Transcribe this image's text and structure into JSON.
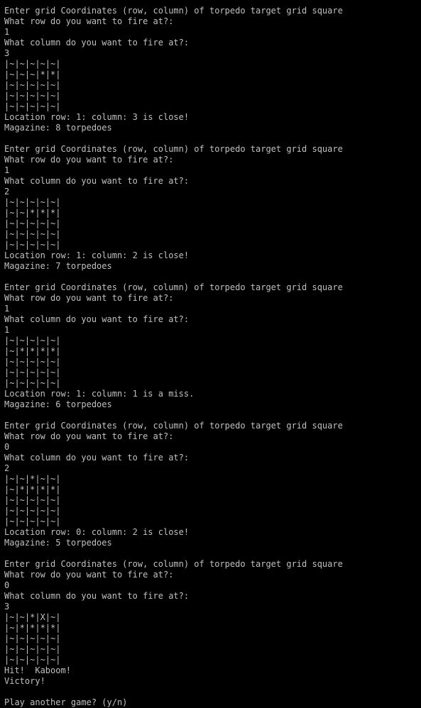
{
  "colors": {
    "background": "#000000",
    "text": "#c0c0c0"
  },
  "console": {
    "rounds": [
      {
        "prompt": "Enter grid Coordinates (row, column) of torpedo target grid square",
        "row_question": "What row do you want to fire at?:",
        "row_answer": "1",
        "column_question": "What column do you want to fire at?:",
        "column_answer": "3",
        "grid": [
          "|~|~|~|~|~|",
          "|~|~|~|*|*|",
          "|~|~|~|~|~|",
          "|~|~|~|~|~|",
          "|~|~|~|~|~|"
        ],
        "result": "Location row: 1: column: 3 is close!",
        "magazine": "Magazine: 8 torpedoes"
      },
      {
        "prompt": "Enter grid Coordinates (row, column) of torpedo target grid square",
        "row_question": "What row do you want to fire at?:",
        "row_answer": "1",
        "column_question": "What column do you want to fire at?:",
        "column_answer": "2",
        "grid": [
          "|~|~|~|~|~|",
          "|~|~|*|*|*|",
          "|~|~|~|~|~|",
          "|~|~|~|~|~|",
          "|~|~|~|~|~|"
        ],
        "result": "Location row: 1: column: 2 is close!",
        "magazine": "Magazine: 7 torpedoes"
      },
      {
        "prompt": "Enter grid Coordinates (row, column) of torpedo target grid square",
        "row_question": "What row do you want to fire at?:",
        "row_answer": "1",
        "column_question": "What column do you want to fire at?:",
        "column_answer": "1",
        "grid": [
          "|~|~|~|~|~|",
          "|~|*|*|*|*|",
          "|~|~|~|~|~|",
          "|~|~|~|~|~|",
          "|~|~|~|~|~|"
        ],
        "result": "Location row: 1: column: 1 is a miss.",
        "magazine": "Magazine: 6 torpedoes"
      },
      {
        "prompt": "Enter grid Coordinates (row, column) of torpedo target grid square",
        "row_question": "What row do you want to fire at?:",
        "row_answer": "0",
        "column_question": "What column do you want to fire at?:",
        "column_answer": "2",
        "grid": [
          "|~|~|*|~|~|",
          "|~|*|*|*|*|",
          "|~|~|~|~|~|",
          "|~|~|~|~|~|",
          "|~|~|~|~|~|"
        ],
        "result": "Location row: 0: column: 2 is close!",
        "magazine": "Magazine: 5 torpedoes"
      },
      {
        "prompt": "Enter grid Coordinates (row, column) of torpedo target grid square",
        "row_question": "What row do you want to fire at?:",
        "row_answer": "0",
        "column_question": "What column do you want to fire at?:",
        "column_answer": "3",
        "grid": [
          "|~|~|*|X|~|",
          "|~|*|*|*|*|",
          "|~|~|~|~|~|",
          "|~|~|~|~|~|",
          "|~|~|~|~|~|"
        ],
        "result": "Hit!  Kaboom!",
        "magazine": "Victory!"
      }
    ],
    "final_prompt": "Play another game? (y/n)"
  }
}
